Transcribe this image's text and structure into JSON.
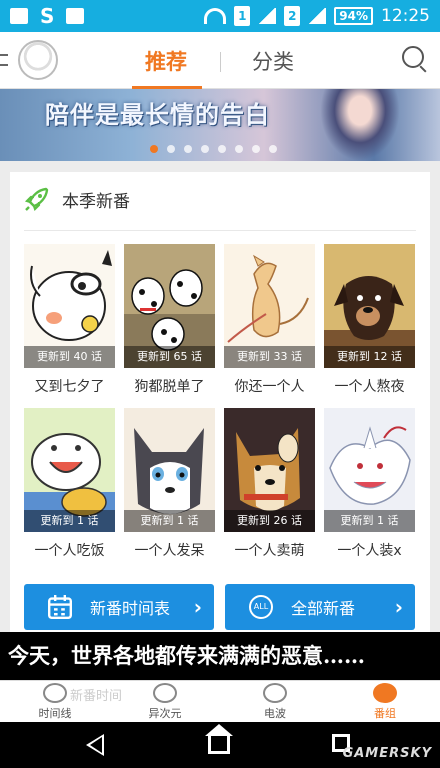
{
  "status_bar": {
    "sim1": "1",
    "sim2": "2",
    "battery": "94%",
    "time": "12:25",
    "carrier_letter": "S"
  },
  "header": {
    "tab_recommend": "推荐",
    "tab_category": "分类",
    "accent_color": "#f07822"
  },
  "banner": {
    "text": "陪伴是最长情的告白",
    "dot_count": 8,
    "active_dot": 1
  },
  "section": {
    "title": "本季新番",
    "icon": "rocket-icon"
  },
  "anime": [
    {
      "badge": "更新到 40 话",
      "title": "又到七夕了"
    },
    {
      "badge": "更新到 65 话",
      "title": "狗都脱单了"
    },
    {
      "badge": "更新到 33 话",
      "title": "你还一个人"
    },
    {
      "badge": "更新到 12 话",
      "title": "一个人熬夜"
    },
    {
      "badge": "更新到 1 话",
      "title": "一个人吃饭"
    },
    {
      "badge": "更新到 1 话",
      "title": "一个人发呆"
    },
    {
      "badge": "更新到 26 话",
      "title": "一个人卖萌"
    },
    {
      "badge": "更新到 1 话",
      "title": "一个人装x"
    }
  ],
  "buttons": {
    "schedule": "新番时间表",
    "all": "全部新番",
    "all_icon_text": "ALL"
  },
  "overlay_caption": "今天，世界各地都传来满满的恶意……",
  "bottom_nav": {
    "ghost_text": "新番时间",
    "items": [
      "时间线",
      "异次元",
      "电波",
      "番组"
    ],
    "active_index": 3
  },
  "watermark": "GAMERSKY"
}
